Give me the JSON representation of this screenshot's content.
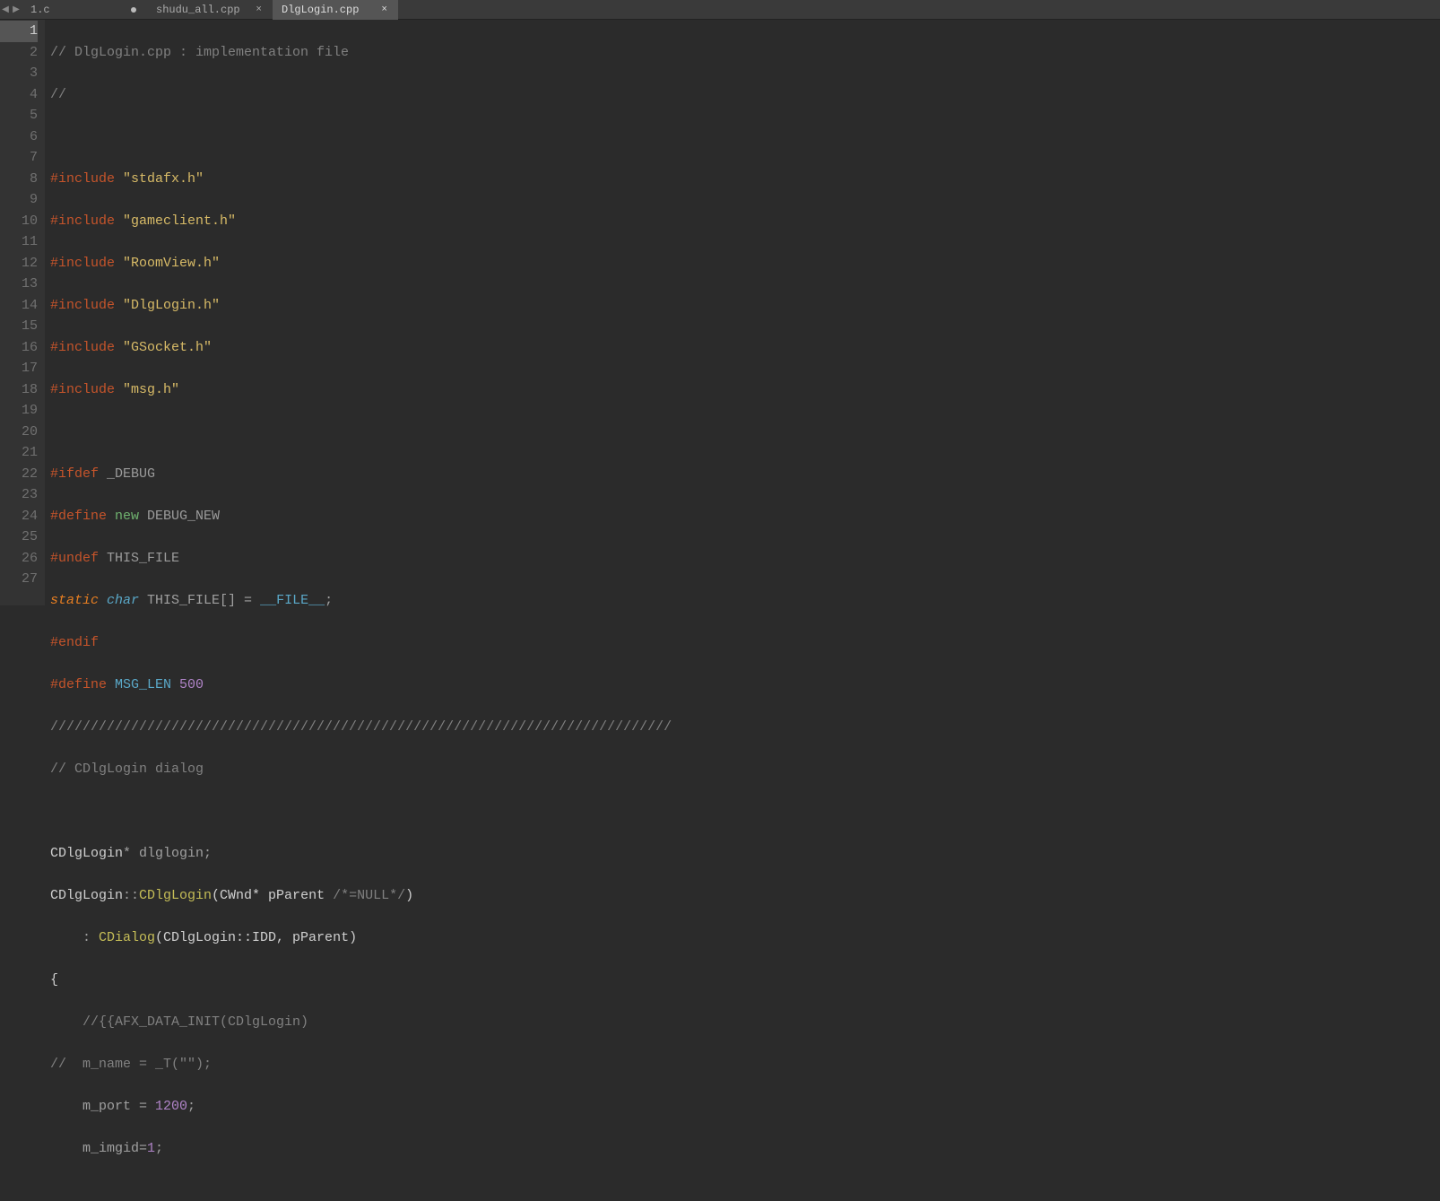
{
  "tabs": {
    "t0": {
      "name": "1.c",
      "modified": true
    },
    "t1": {
      "name": "shudu_all.cpp"
    },
    "t2": {
      "name": "DlgLogin.cpp"
    }
  },
  "gutter": {
    "start": 1,
    "end": 27,
    "current": 1
  },
  "code": {
    "l1": {
      "c1": "// DlgLogin.cpp : implementation file"
    },
    "l2": {
      "c1": "//"
    },
    "l3": {},
    "l4": {
      "pp": "#include",
      "str": "\"stdafx.h\""
    },
    "l5": {
      "pp": "#include",
      "str": "\"gameclient.h\""
    },
    "l6": {
      "pp": "#include",
      "str": "\"RoomView.h\""
    },
    "l7": {
      "pp": "#include",
      "str": "\"DlgLogin.h\""
    },
    "l8": {
      "pp": "#include",
      "str": "\"GSocket.h\""
    },
    "l9": {
      "pp": "#include",
      "str": "\"msg.h\""
    },
    "l10": {},
    "l11": {
      "pp": "#ifdef ",
      "macro": "_DEBUG"
    },
    "l12": {
      "pp": "#define ",
      "kw": "new",
      "macro": " DEBUG_NEW"
    },
    "l13": {
      "pp": "#undef ",
      "macro": "THIS_FILE"
    },
    "l14": {
      "kw": "static",
      "type": " char",
      "rest": " THIS_FILE[] = ",
      "file": "__FILE__",
      "semi": ";"
    },
    "l15": {
      "pp": "#endif"
    },
    "l16": {
      "pp": "#define ",
      "defname": "MSG_LEN ",
      "num": "500"
    },
    "l17": {
      "c1": "/////////////////////////////////////////////////////////////////////////////"
    },
    "l18": {
      "c1": "// CDlgLogin dialog"
    },
    "l19": {},
    "l20": {
      "a": "CDlgLogin",
      "b": "* dlglogin;"
    },
    "l21": {
      "a": "CDlgLogin",
      "b": "::",
      "c": "CDlgLogin",
      "d": "(CWnd* pParent ",
      "e": "/*=NULL*/",
      "f": ")"
    },
    "l22": {
      "a": "    : ",
      "b": "CDialog",
      "c": "(CDlgLogin::IDD, pParent)"
    },
    "l23": {
      "a": "{"
    },
    "l24": {
      "a": "    ",
      "c": "//{{AFX_DATA_INIT(CDlgLogin)"
    },
    "l25": {
      "c": "//  m_name = _T(\"\");"
    },
    "l26": {
      "a": "    m_port = ",
      "n": "1200",
      "b": ";"
    },
    "l27": {
      "a": "    m_imgid=",
      "n": "1",
      "b": ";"
    }
  }
}
